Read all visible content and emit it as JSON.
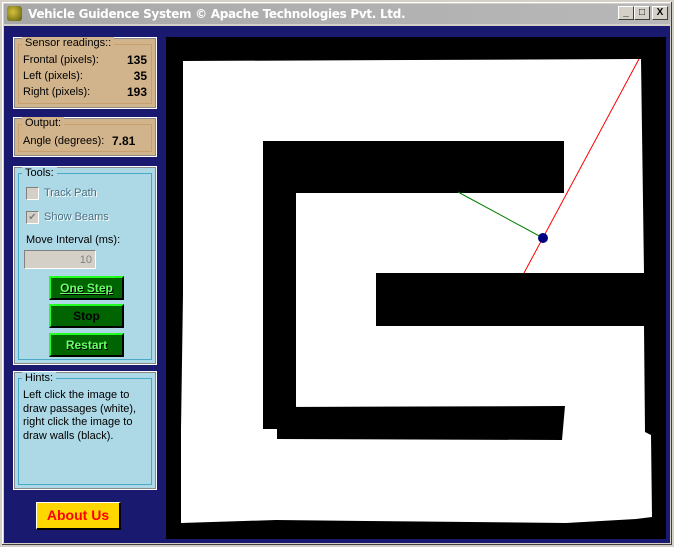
{
  "window": {
    "title": "Vehicle Guidence System © Apache Technologies Pvt. Ltd.",
    "controls": [
      "_",
      "□",
      "X"
    ]
  },
  "sensor": {
    "title": "Sensor readings::",
    "rows": [
      {
        "label": "Frontal (pixels):",
        "value": "135"
      },
      {
        "label": "Left (pixels):",
        "value": "35"
      },
      {
        "label": "Right (pixels):",
        "value": "193"
      }
    ]
  },
  "output": {
    "title": "Output:",
    "label": "Angle (degrees):",
    "value": "7.81"
  },
  "tools": {
    "title": "Tools:",
    "track_path": {
      "label": "Track Path",
      "checked": false,
      "enabled": false
    },
    "show_beams": {
      "label": "Show Beams",
      "checked": true,
      "enabled": false
    },
    "interval_label": "Move Interval (ms):",
    "interval_value": "10",
    "one_step": "One Step",
    "stop": "Stop",
    "restart": "Restart"
  },
  "hints": {
    "title": "Hints:",
    "text": "Left click the image to draw passages (white), right click the image to draw walls (black)."
  },
  "about": "About Us",
  "colors": {
    "client_bg": "#191970",
    "sensor_panel": "#d2b48c",
    "tools_panel": "#add8e6",
    "button_green": "#006400",
    "about_bg": "#ffd700",
    "about_text": "#ff0000",
    "vehicle": "#000080",
    "front_beam": "#ff0000",
    "side_beam": "#008000"
  }
}
